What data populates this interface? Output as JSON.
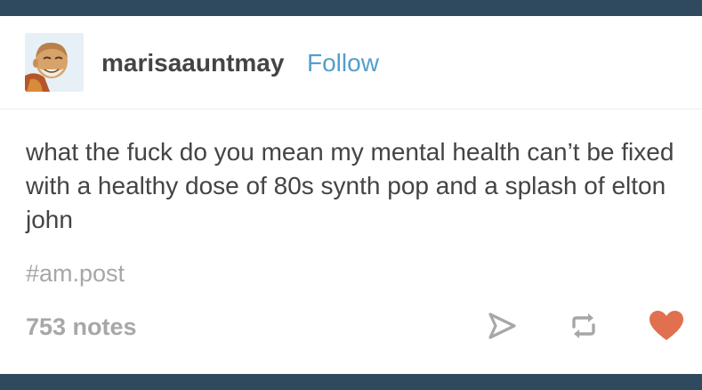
{
  "post": {
    "username": "marisaauntmay",
    "follow_label": "Follow",
    "body_text": "what the fuck do you mean my mental health can’t be fixed with a healthy dose of 80s synth pop and a splash of elton john",
    "tag": "#am.post",
    "notes": "753 notes"
  },
  "icons": {
    "share": "paper-plane-icon",
    "reblog": "reblog-icon",
    "like": "heart-icon"
  },
  "colors": {
    "frame": "#2f4a5e",
    "text": "#444444",
    "muted": "#a7a7a7",
    "link": "#529ecc",
    "heart": "#e0704f"
  }
}
